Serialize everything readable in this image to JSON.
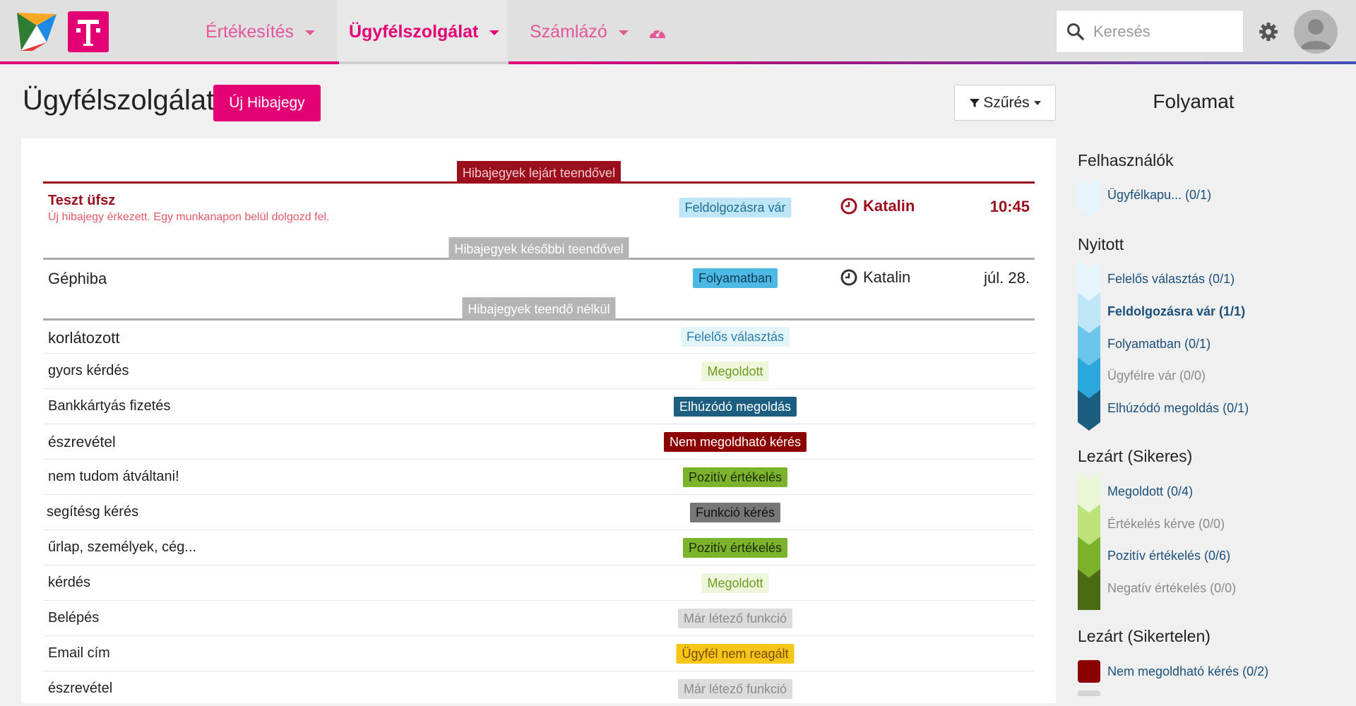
{
  "header": {
    "nav": [
      {
        "label": "Értékesítés",
        "active": false
      },
      {
        "label": "Ügyfélszolgálat",
        "active": true
      },
      {
        "label": "Számlázó",
        "active": false
      }
    ],
    "search_placeholder": "Keresés",
    "brand_color": "#e20074"
  },
  "page": {
    "title": "Ügyfélszolgálat",
    "new_button": "Új Hibajegy",
    "filter_button": "Szűrés"
  },
  "sections": {
    "overdue": "Hibajegyek lejárt teendővel",
    "later": "Hibajegyek későbbi teendővel",
    "none": "Hibajegyek teendő nélkül"
  },
  "tickets": {
    "overdue": {
      "title": "Teszt üfsz",
      "subtitle": "Új hibajegy érkezett. Egy munkanapon belül dolgozd fel.",
      "status": "Feldolgozásra vár",
      "assignee": "Katalin",
      "time": "10:45"
    },
    "later": {
      "title": "Géphiba",
      "status": "Folyamatban",
      "assignee": "Katalin",
      "time": "júl. 28."
    },
    "none": [
      {
        "title": "korlátozott",
        "status": "Felelős választás",
        "bg": "#e3f4fb",
        "fg": "#2b7fa8"
      },
      {
        "title": "gyors kérdés",
        "status": "Megoldott",
        "bg": "#eef7dc",
        "fg": "#6f9a1f"
      },
      {
        "title": "Bankkártyás fizetés",
        "status": "Elhúzódó megoldás",
        "bg": "#1b5e80",
        "fg": "#ffffff"
      },
      {
        "title": "észrevétel",
        "status": "Nem megoldható kérés",
        "bg": "#8b0000",
        "fg": "#ffffff"
      },
      {
        "title": "nem tudom átváltani!",
        "status": "Pozitív értékelés",
        "bg": "#7cb32d",
        "fg": "#1e2a08"
      },
      {
        "title": "segítésg kérés",
        "status": "Funkció kérés",
        "bg": "#777777",
        "fg": "#111111"
      },
      {
        "title": "űrlap, személyek, cég...",
        "status": "Pozitív értékelés",
        "bg": "#7cb32d",
        "fg": "#1e2a08"
      },
      {
        "title": "kérdés",
        "status": "Megoldott",
        "bg": "#eef7dc",
        "fg": "#6f9a1f"
      },
      {
        "title": "Belépés",
        "status": "Már létező funkció",
        "bg": "#dcdcdc",
        "fg": "#8a8a8a"
      },
      {
        "title": "Email cím",
        "status": "Ügyfél nem reagált",
        "bg": "#f5c518",
        "fg": "#7a4b00"
      },
      {
        "title": "észrevétel",
        "status": "Már létező funkció",
        "bg": "#dcdcdc",
        "fg": "#8a8a8a"
      }
    ]
  },
  "sidebar": {
    "title": "Folyamat",
    "groups": [
      {
        "heading": "Felhasználók",
        "items": [
          {
            "label": "Ügyfélkapu... (0/1)",
            "style": "normal"
          }
        ]
      },
      {
        "heading": "Nyitott",
        "items": [
          {
            "label": "Felelős választás (0/1)",
            "style": "normal"
          },
          {
            "label": "Feldolgozásra vár (1/1)",
            "style": "bold"
          },
          {
            "label": "Folyamatban (0/1)",
            "style": "normal"
          },
          {
            "label": "Ügyfélre vár (0/0)",
            "style": "gray"
          },
          {
            "label": "Elhúzódó megoldás (0/1)",
            "style": "normal"
          }
        ]
      },
      {
        "heading": "Lezárt (Sikeres)",
        "items": [
          {
            "label": "Megoldott (0/4)",
            "style": "normal"
          },
          {
            "label": "Értékelés kérve (0/0)",
            "style": "gray"
          },
          {
            "label": "Pozitív értékelés (0/6)",
            "style": "normal"
          },
          {
            "label": "Negatív értékelés (0/0)",
            "style": "gray"
          }
        ]
      },
      {
        "heading": "Lezárt (Sikertelen)",
        "items": [
          {
            "label": "Nem megoldható kérés (0/2)",
            "style": "normal"
          }
        ]
      }
    ]
  },
  "colors": {
    "overdue": "#9b0e1c",
    "later_line": "#aaaaaa",
    "status_waiting_bg": "#bfe6f6",
    "status_progress_bg": "#4fb9e6"
  }
}
